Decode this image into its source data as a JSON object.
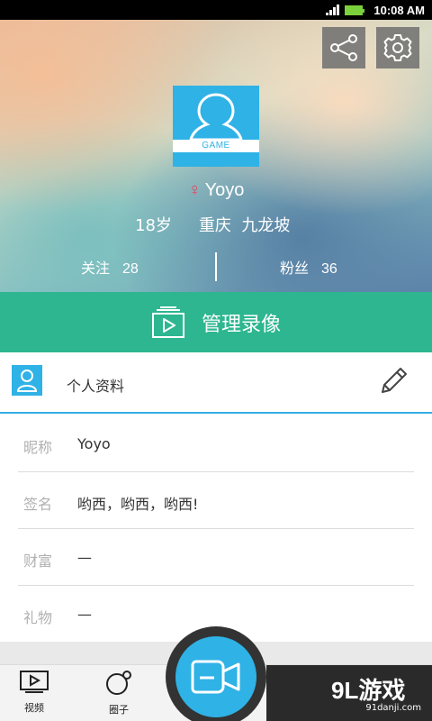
{
  "status_bar": {
    "time": "10:08 AM"
  },
  "header": {
    "share_icon": "share-icon",
    "settings_icon": "gear-icon",
    "avatar_text": "GAME",
    "gender_symbol": "♀",
    "name": "Yoyo",
    "age": "18岁",
    "location": "重庆  九龙坡",
    "follow_label": "关注",
    "follow_count": "28",
    "fans_label": "粉丝",
    "fans_count": "36"
  },
  "manage_bar": {
    "label": "管理录像",
    "icon": "video-library-icon",
    "color": "#2db690"
  },
  "profile": {
    "title": "个人资料",
    "fields": [
      {
        "label": "昵称",
        "value": "Yoyo"
      },
      {
        "label": "签名",
        "value": "哟西，哟西，哟西!"
      },
      {
        "label": "财富",
        "value": "—"
      },
      {
        "label": "礼物",
        "value": "—"
      }
    ]
  },
  "bottom_nav": {
    "videos_label": "视频",
    "circle_label": "圈子",
    "record_icon": "video-camera-icon"
  },
  "watermark": {
    "brand": "9L游戏",
    "url": "91danji.com"
  },
  "colors": {
    "accent_blue": "#2fb2e6",
    "accent_green": "#2db690",
    "female_red": "#e2465e"
  }
}
